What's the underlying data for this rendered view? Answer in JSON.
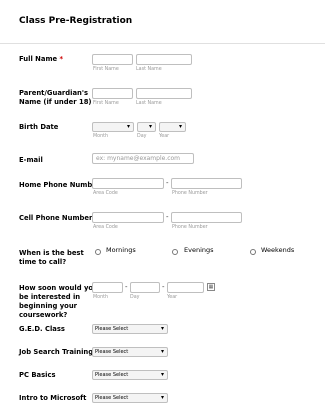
{
  "form": {
    "title": "Class Pre-Registration",
    "full_name": {
      "label": "Full Name",
      "req": "*",
      "first": "First Name",
      "last": "Last Name"
    },
    "guardian": {
      "label1": "Parent/Guardian's",
      "label2": "Name (if under 18)",
      "first": "First Name",
      "last": "Last Name"
    },
    "birth": {
      "label": "Birth Date",
      "month": "Month",
      "day": "Day",
      "year": "Year"
    },
    "email": {
      "label": "E-mail",
      "placeholder": "ex: myname@example.com"
    },
    "home_phone": {
      "label": "Home Phone Number",
      "area": "Area Code",
      "number": "Phone Number",
      "dash": "-"
    },
    "cell_phone": {
      "label": "Cell Phone Number",
      "area": "Area Code",
      "number": "Phone Number",
      "dash": "-"
    },
    "best_time": {
      "label1": "When is the best",
      "label2": "time to call?",
      "options": [
        "Mornings",
        "Evenings",
        "Weekends"
      ]
    },
    "start": {
      "l1": "How soon would you",
      "l2": "be interested in",
      "l3": "beginning your",
      "l4": "coursework?",
      "month": "Month",
      "day": "Day",
      "year": "Year",
      "dash": "-"
    },
    "courses": [
      {
        "label": "G.E.D. Class",
        "value": "Please Select"
      },
      {
        "label": "Job Search Training",
        "value": "Please Select"
      },
      {
        "label": "PC Basics",
        "value": "Please Select"
      },
      {
        "label": "Intro to Microsoft",
        "value": "Please Select"
      }
    ]
  }
}
